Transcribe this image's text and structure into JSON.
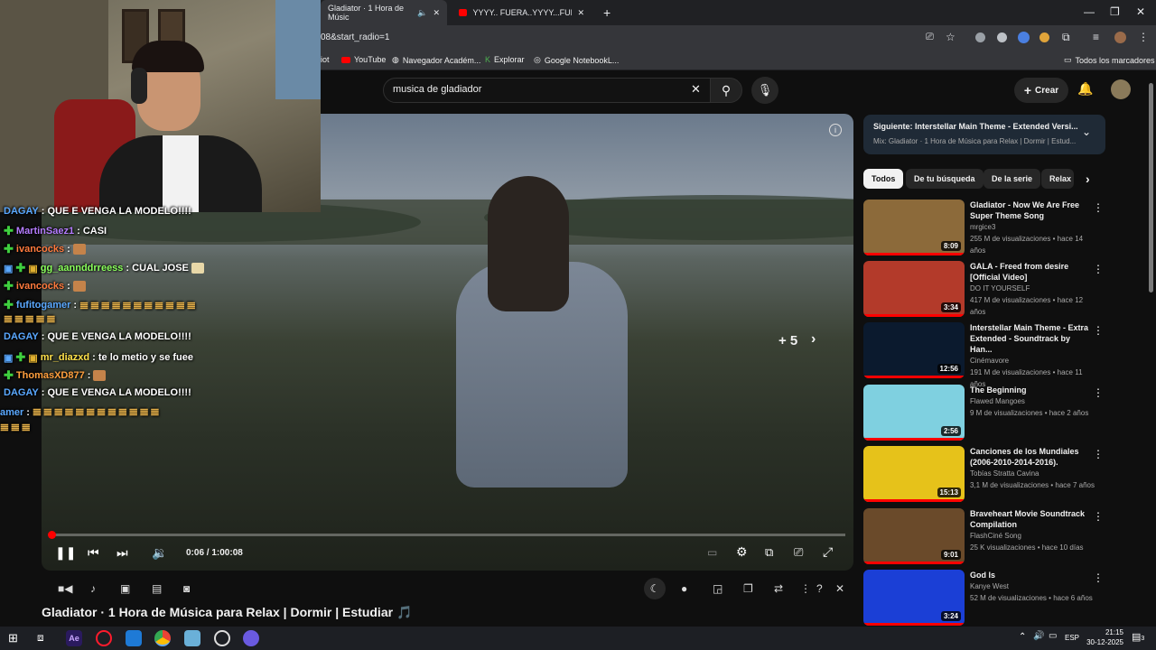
{
  "browser": {
    "tabs": [
      {
        "label": "Gladiator · 1 Hora de Músic",
        "active": true
      },
      {
        "label": "YYYY.. FUERA..YYYY...FUERA - (",
        "active": false
      }
    ],
    "url_fragment": "08&start_radio=1",
    "bookmarks": [
      {
        "label": "iot",
        "icon": "bookmark-icon"
      },
      {
        "label": "YouTube",
        "icon": "youtube-icon"
      },
      {
        "label": "Navegador Académ...",
        "icon": "globe-icon"
      },
      {
        "label": "Explorar",
        "icon": "explore-icon"
      },
      {
        "label": "Google NotebookL...",
        "icon": "notebooklm-icon"
      }
    ],
    "all_bookmarks_label": "Todos los marcadores"
  },
  "youtube": {
    "search_value": "musica de gladiador",
    "create_label": "Crear"
  },
  "player": {
    "time": "0:06 / 1:00:08",
    "progress_fraction": 0.0017,
    "endscreen_more": "+ 5"
  },
  "video_title": "Gladiator · 1 Hora de Música para Relax | Dormir | Estudiar 🎵",
  "chat": [
    {
      "user": "DAGAY",
      "text": ": QUE E VENGA LA MODELO!!!!",
      "color": "#5aa8ff"
    },
    {
      "user": "MartinSaez1",
      "text": ": CASI",
      "color": "#b57cff"
    },
    {
      "user": "ivancocks",
      "text": ":",
      "color": "#ff7a3d"
    },
    {
      "user": "gg_aannddrreess",
      "text": ": CUAL JOSE",
      "color": "#8aff5c"
    },
    {
      "user": "ivancocks",
      "text": ":",
      "color": "#ff7a3d"
    },
    {
      "user": "fufitogamer",
      "text": ":",
      "color": "#5aa8ff"
    },
    {
      "user": "DAGAY",
      "text": ": QUE E VENGA LA MODELO!!!!",
      "color": "#5aa8ff"
    },
    {
      "user": "mr_diazxd",
      "text": ": te lo metio y se fuee",
      "color": "#ffe14a"
    },
    {
      "user": "ThomasXD877",
      "text": ":",
      "color": "#ff9f3d"
    },
    {
      "user": "DAGAY",
      "text": ": QUE E VENGA LA MODELO!!!!",
      "color": "#5aa8ff"
    },
    {
      "user": "amer",
      "text": ":",
      "color": "#5aa8ff"
    }
  ],
  "up_next": {
    "label": "Siguiente:",
    "title": "Interstellar Main Theme - Extended Versi...",
    "mix": "Mix: Gladiator · 1 Hora de Música para Relax | Dormir | Estud..."
  },
  "chips": [
    "Todos",
    "De tu búsqueda",
    "De la serie",
    "Relax"
  ],
  "recommendations": [
    {
      "title": "Gladiator - Now We Are Free Super Theme Song",
      "channel": "mrgice3",
      "views": "255 M de visualizaciones",
      "age": "hace 14 años",
      "duration": "8:09",
      "color": "#8c6a3a"
    },
    {
      "title": "GALA - Freed from desire [Official Video]",
      "channel": "DO IT YOURSELF",
      "views": "417 M de visualizaciones",
      "age": "hace 12 años",
      "duration": "3:34",
      "color": "#b33a2a"
    },
    {
      "title": "Interstellar Main Theme - Extra Extended - Soundtrack by  Han...",
      "channel": "Cinémavore",
      "views": "191 M de visualizaciones",
      "age": "hace 11 años",
      "duration": "12:56",
      "color": "#0b1a2e"
    },
    {
      "title": "The Beginning",
      "channel": "Flawed Mangoes",
      "views": "9 M de visualizaciones",
      "age": "hace 2 años",
      "duration": "2:56",
      "color": "#7fd0e0"
    },
    {
      "title": "Canciones de los Mundiales (2006-2010-2014-2016).",
      "channel": "Tobías Stratta Cavina",
      "views": "3,1 M de visualizaciones",
      "age": "hace 7 años",
      "duration": "15:13",
      "color": "#e6c21a"
    },
    {
      "title": "Braveheart Movie  Soundtrack Compilation",
      "channel": "FlashCiné Song",
      "views": "25 K visualizaciones",
      "age": "hace 10 días",
      "duration": "9:01",
      "color": "#6a4a2a"
    },
    {
      "title": "God Is",
      "channel": "Kanye West",
      "views": "52 M de visualizaciones",
      "age": "hace 6 años",
      "duration": "3:24",
      "color": "#1b3fd6"
    }
  ],
  "taskbar": {
    "lang": "ESP",
    "time": "21:15",
    "date": "30-12-2025",
    "notif_count": "3"
  }
}
